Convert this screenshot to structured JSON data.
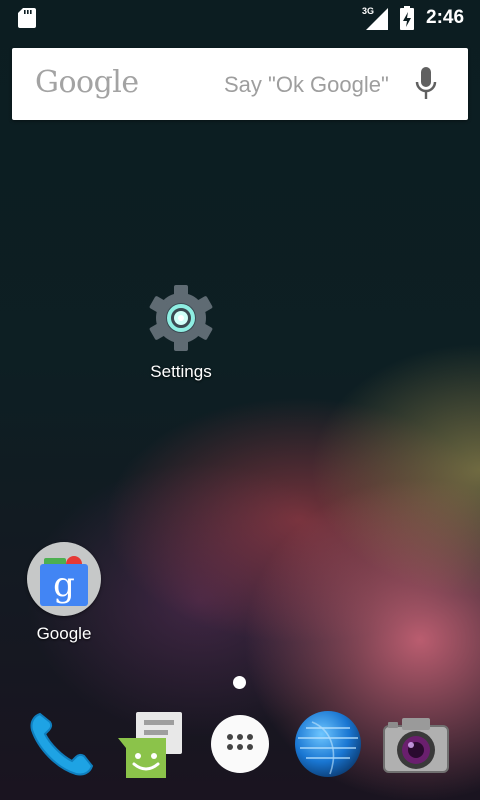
{
  "status_bar": {
    "time": "2:46",
    "network_type": "3G",
    "icons": [
      "sd-card-icon",
      "cell-signal-icon",
      "battery-charging-icon"
    ]
  },
  "search_bar": {
    "logo_text": "Google",
    "hint": "Say \"Ok Google\"",
    "icon": "microphone-icon"
  },
  "desktop": {
    "shortcuts": [
      {
        "label": "Settings",
        "icon": "gear-icon"
      },
      {
        "label": "Google",
        "icon": "google-folder-icon"
      }
    ],
    "current_page": 1,
    "page_count": 1
  },
  "dock": {
    "items": [
      {
        "name": "phone",
        "icon": "phone-icon"
      },
      {
        "name": "messaging",
        "icon": "messaging-icon"
      },
      {
        "name": "all-apps",
        "icon": "app-drawer-icon"
      },
      {
        "name": "browser",
        "icon": "globe-icon"
      },
      {
        "name": "camera",
        "icon": "camera-icon"
      }
    ]
  },
  "colors": {
    "search_bg": "#ffffff",
    "hint_text": "#9e9e9e",
    "settings_teal": "#7fe3d6",
    "messaging_green": "#8bc34a",
    "phone_blue": "#1ea3e4"
  }
}
